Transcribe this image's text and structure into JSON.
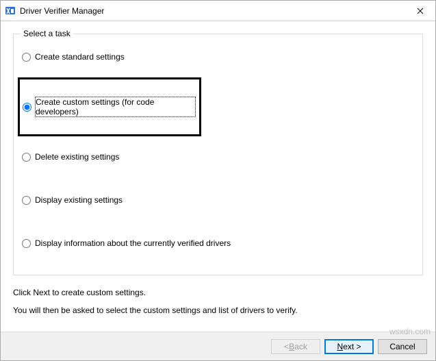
{
  "window": {
    "title": "Driver Verifier Manager"
  },
  "groupbox": {
    "label": "Select a task"
  },
  "options": {
    "create_standard": "Create standard settings",
    "create_custom": "Create custom settings (for code developers)",
    "delete_existing": "Delete existing settings",
    "display_existing": "Display existing settings",
    "display_info": "Display information about the currently verified drivers"
  },
  "instructions": {
    "line1": "Click Next to create custom settings.",
    "line2": "You will then be asked to select the custom settings and list of drivers to verify."
  },
  "buttons": {
    "back_prefix": "< ",
    "back_accel": "B",
    "back_suffix": "ack",
    "next_accel": "N",
    "next_suffix": "ext >",
    "cancel": "Cancel"
  },
  "watermark": "wsxdn.com"
}
